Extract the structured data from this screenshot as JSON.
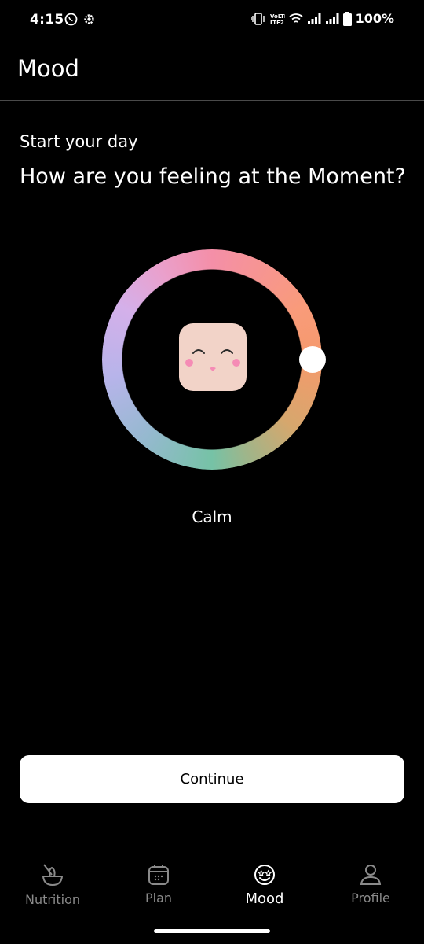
{
  "status_bar": {
    "time": "4:15",
    "battery_percent": "100%",
    "left_icons": [
      "whatsapp-icon",
      "settings-icon"
    ],
    "right_icons": [
      "vibrate-icon",
      "volte-icon",
      "wifi-icon",
      "signal-icon",
      "signal-icon",
      "battery-icon"
    ]
  },
  "header": {
    "title": "Mood"
  },
  "main": {
    "subtitle": "Start your day",
    "question": "How are you feeling at the Moment?",
    "selected_mood": "Calm",
    "continue_label": "Continue"
  },
  "nav": {
    "items": [
      {
        "label": "Nutrition",
        "icon": "bowl-icon",
        "active": false
      },
      {
        "label": "Plan",
        "icon": "calendar-icon",
        "active": false
      },
      {
        "label": "Mood",
        "icon": "smiley-icon",
        "active": true
      },
      {
        "label": "Profile",
        "icon": "person-icon",
        "active": false
      }
    ]
  },
  "colors": {
    "background": "#000000",
    "button_bg": "#ffffff",
    "face": "#f2d3c8",
    "blush": "#f58bb5",
    "nav_inactive": "#8a8a8a"
  }
}
